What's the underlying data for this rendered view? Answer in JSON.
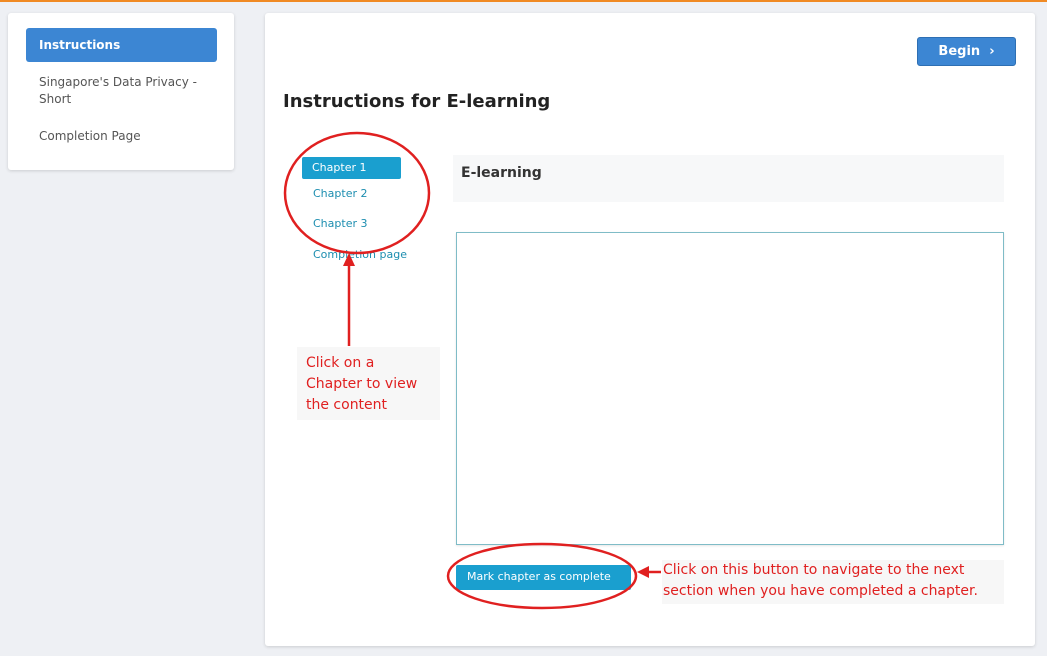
{
  "sidebar": {
    "items": [
      {
        "label": "Instructions"
      },
      {
        "label": "Singapore's Data Privacy - Short"
      },
      {
        "label": "Completion Page"
      }
    ]
  },
  "main": {
    "begin_label": "Begin",
    "title": "Instructions for E-learning",
    "chapters": [
      {
        "label": "Chapter 1"
      },
      {
        "label": "Chapter 2"
      },
      {
        "label": "Chapter 3"
      },
      {
        "label": "Completion page"
      }
    ],
    "content_header": "E-learning",
    "mark_complete_label": "Mark chapter as complete"
  },
  "annotations": {
    "chapter_note": "Click on a Chapter to view the content",
    "button_note": "Click on this button to navigate to the next section when you have completed  a chapter."
  },
  "colors": {
    "accent": "#3c86d3",
    "teal": "#1a9fcf",
    "annotation": "#e02020",
    "top_border": "#f08a24"
  }
}
